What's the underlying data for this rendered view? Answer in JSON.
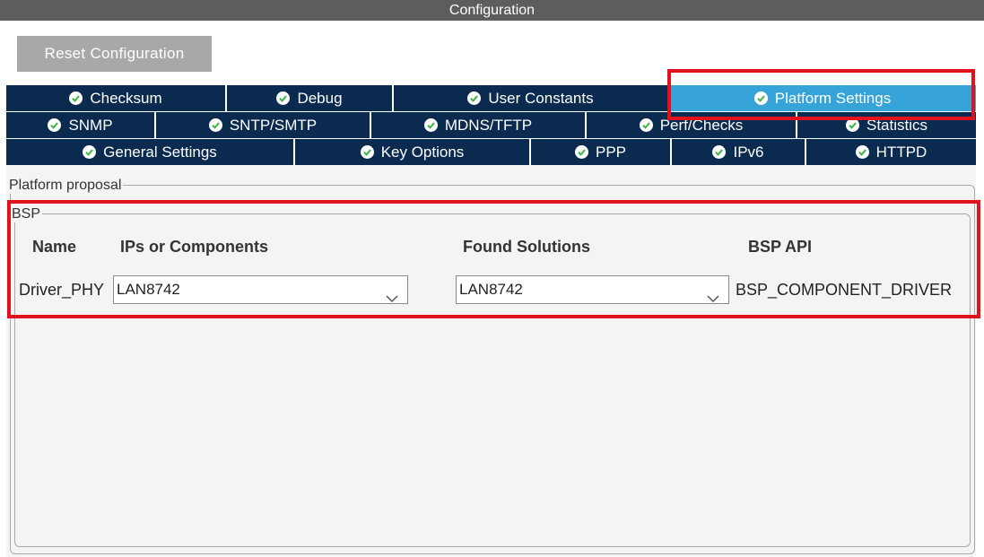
{
  "window": {
    "title": "Configuration"
  },
  "toolbar": {
    "reset_label": "Reset Configuration"
  },
  "tabs": {
    "row1": [
      {
        "label": "Checksum"
      },
      {
        "label": "Debug"
      },
      {
        "label": "User Constants"
      },
      {
        "label": "Platform Settings",
        "active": true
      }
    ],
    "row2": [
      {
        "label": "SNMP"
      },
      {
        "label": "SNTP/SMTP"
      },
      {
        "label": "MDNS/TFTP"
      },
      {
        "label": "Perf/Checks"
      },
      {
        "label": "Statistics"
      }
    ],
    "row3": [
      {
        "label": "General Settings"
      },
      {
        "label": "Key Options"
      },
      {
        "label": "PPP"
      },
      {
        "label": "IPv6"
      },
      {
        "label": "HTTPD"
      }
    ]
  },
  "platform": {
    "group_title": "Platform proposal",
    "bsp": {
      "group_title": "BSP",
      "headers": {
        "name": "Name",
        "ips": "IPs or Components",
        "found": "Found Solutions",
        "api": "BSP API"
      },
      "row": {
        "name": "Driver_PHY",
        "ip_value": "LAN8742",
        "found_value": "LAN8742",
        "api_value": "BSP_COMPONENT_DRIVER"
      }
    }
  },
  "colors": {
    "title_bar": "#5d5d5d",
    "tab_bg": "#0b2a4f",
    "tab_active": "#36a3d9",
    "check_icon": "#3fb847",
    "highlight": "#e3111b"
  }
}
